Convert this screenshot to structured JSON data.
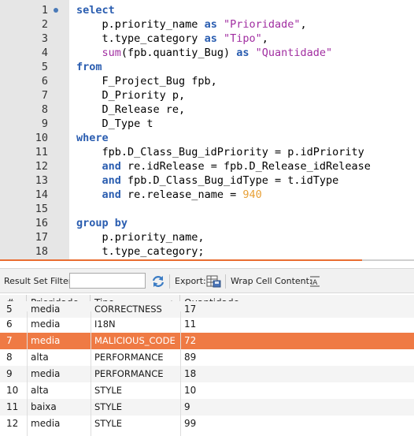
{
  "editor": {
    "lines": [
      {
        "n": "1",
        "html": "<span class='kw'>select</span>"
      },
      {
        "n": "2",
        "html": "    p.priority_name <span class='kw'>as</span> <span class='str'>\"Prioridade\"</span>,"
      },
      {
        "n": "3",
        "html": "    t.type_category <span class='kw'>as</span> <span class='str'>\"Tipo\"</span>,"
      },
      {
        "n": "4",
        "html": "    <span class='fn'>sum</span>(fpb.quantiy_Bug) <span class='kw'>as</span> <span class='str'>\"Quantidade\"</span>"
      },
      {
        "n": "5",
        "html": "<span class='kw'>from</span>"
      },
      {
        "n": "6",
        "html": "    F_Project_Bug fpb,"
      },
      {
        "n": "7",
        "html": "    D_Priority p,"
      },
      {
        "n": "8",
        "html": "    D_Release re,"
      },
      {
        "n": "9",
        "html": "    D_Type t"
      },
      {
        "n": "10",
        "html": "<span class='kw'>where</span>"
      },
      {
        "n": "11",
        "html": "    fpb.D_Class_Bug_idPriority = p.idPriority"
      },
      {
        "n": "12",
        "html": "    <span class='kw'>and</span> re.idRelease = fpb.D_Release_idRelease"
      },
      {
        "n": "13",
        "html": "    <span class='kw'>and</span> fpb.D_Class_Bug_idType = t.idType"
      },
      {
        "n": "14",
        "html": "    <span class='kw'>and</span> re.release_name = <span class='num'>940</span>"
      },
      {
        "n": "15",
        "html": ""
      },
      {
        "n": "16",
        "html": "<span class='kw'>group by</span>"
      },
      {
        "n": "17",
        "html": "    p.priority_name,"
      },
      {
        "n": "18",
        "html": "    t.type_category;"
      }
    ]
  },
  "toolbar": {
    "filter_label": "Result Set Filter:",
    "filter_value": "",
    "export_label": "Export:",
    "wrap_label": "Wrap Cell Content:"
  },
  "grid": {
    "headers": [
      "#",
      "Prioridade",
      "Tipo",
      "Quantidade"
    ],
    "sorted_column": "Tipo",
    "partial_row": {
      "idx": "5",
      "prioridade": "media",
      "tipo": "CORRECTNESS",
      "quantidade": "17"
    },
    "rows": [
      {
        "idx": "6",
        "prioridade": "media",
        "tipo": "I18N",
        "quantidade": "11"
      },
      {
        "idx": "7",
        "prioridade": "media",
        "tipo": "MALICIOUS_CODE",
        "quantidade": "72",
        "selected": true
      },
      {
        "idx": "8",
        "prioridade": "alta",
        "tipo": "PERFORMANCE",
        "quantidade": "89"
      },
      {
        "idx": "9",
        "prioridade": "media",
        "tipo": "PERFORMANCE",
        "quantidade": "18"
      },
      {
        "idx": "10",
        "prioridade": "alta",
        "tipo": "STYLE",
        "quantidade": "10"
      },
      {
        "idx": "11",
        "prioridade": "baixa",
        "tipo": "STYLE",
        "quantidade": "9"
      },
      {
        "idx": "12",
        "prioridade": "media",
        "tipo": "STYLE",
        "quantidade": "99"
      }
    ]
  },
  "colors": {
    "keyword": "#2a5db0",
    "string": "#a12ea1",
    "number": "#e8a036",
    "selection": "#ef7a44"
  }
}
